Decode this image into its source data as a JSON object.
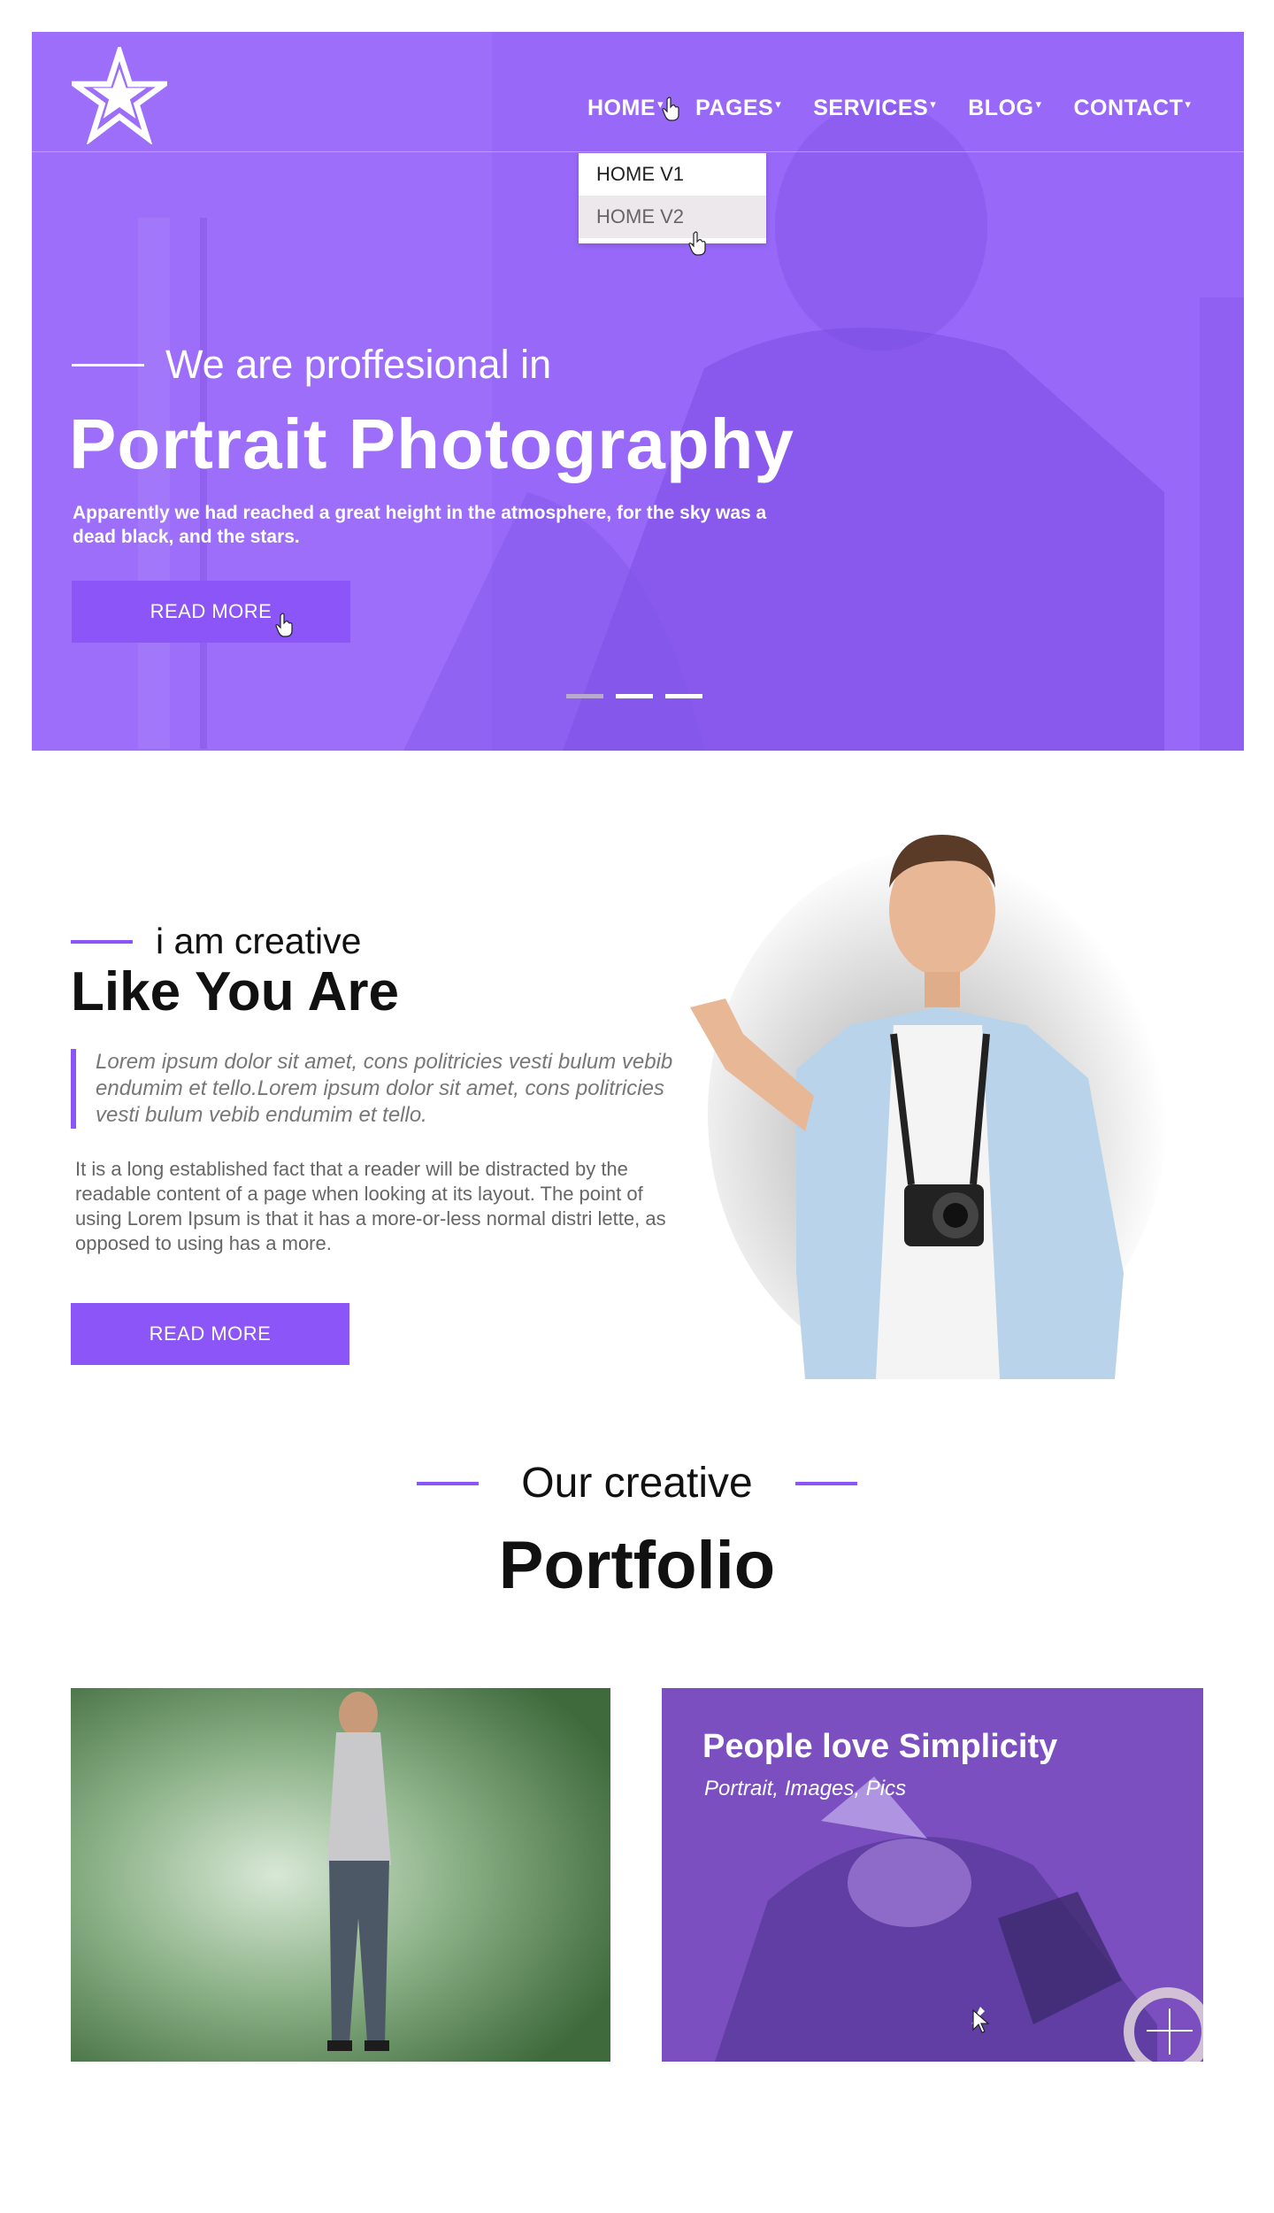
{
  "colors": {
    "accent": "#8b55f8",
    "hero_overlay": "#9b6bf9",
    "text_dark": "#111111",
    "text_muted": "#777777"
  },
  "nav": {
    "items": [
      {
        "label": "HOME",
        "caret": "▾"
      },
      {
        "label": "PAGES",
        "caret": "▾"
      },
      {
        "label": "SERVICES",
        "caret": "▾"
      },
      {
        "label": "BLOG",
        "caret": "▾"
      },
      {
        "label": "CONTACT",
        "caret": "▾"
      }
    ],
    "dropdown": [
      "HOME V1",
      "HOME V2"
    ]
  },
  "hero": {
    "subtitle": "We are proffesional in",
    "title": "Portrait Photography",
    "description": "Apparently we had reached a great height in the atmosphere, for the sky was a dead black, and the stars.",
    "button": "READ MORE",
    "slides": 3,
    "active_slide": 1
  },
  "about": {
    "subtitle": "i am creative",
    "title": "Like You Are",
    "quote": "Lorem ipsum dolor sit amet, cons politricies vesti bulum vebib endumim et tello.Lorem ipsum dolor sit amet, cons politricies vesti bulum vebib endumim et tello.",
    "body": "It is a long established fact that a reader will be distracted by the readable content of a page when looking at its layout. The point of using Lorem Ipsum is that it has a more-or-less normal distri lette, as opposed to using has a more.",
    "button": "READ MORE"
  },
  "portfolio": {
    "subtitle": "Our creative",
    "title": "Portfolio",
    "cards": [
      {
        "title": "",
        "tags": ""
      },
      {
        "title": "People love Simplicity",
        "tags": "Portrait, Images, Pics"
      }
    ]
  }
}
